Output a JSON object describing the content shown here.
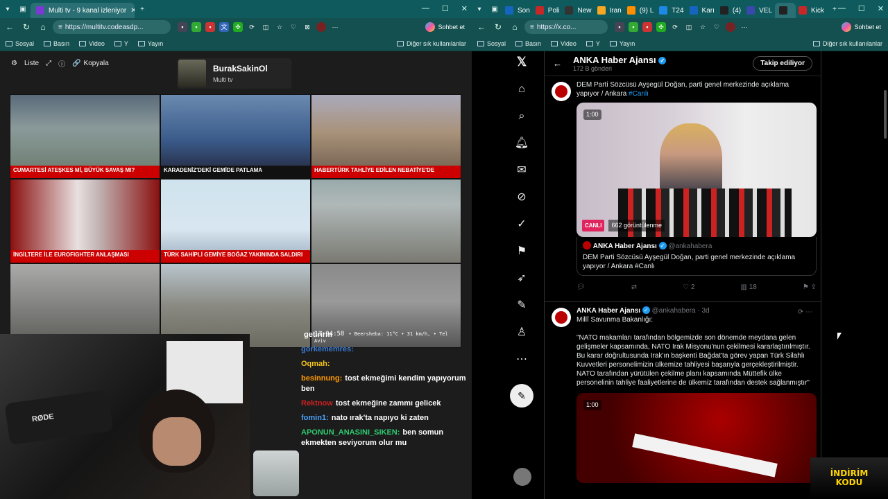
{
  "left_browser": {
    "active_tab": "Multi tv - 9 kanal izleniyor",
    "url": "https://multitv.codeasdp...",
    "copilot": "Sohbet et",
    "bookmarks": [
      "Sosyal",
      "Basın",
      "Video",
      "Y",
      "Yayın"
    ],
    "other_bookmarks": "Diğer sık kullanılanlar"
  },
  "right_browser": {
    "tabs": [
      "Son",
      "Poli",
      "New",
      "Iran",
      "(9) L",
      "T24",
      "Karı",
      "(4) ",
      "VEL",
      "",
      "Kick"
    ],
    "url": "https://x.co...",
    "copilot": "Sohbet et",
    "bookmarks": [
      "Sosyal",
      "Basın",
      "Video",
      "Y",
      "Yayın"
    ],
    "other_bookmarks": "Diğer sık kullanılanlar"
  },
  "multitv": {
    "toolbar": {
      "list": "Liste",
      "copy": "Kopyala"
    },
    "channel": {
      "name": "BurakSakinOl",
      "sub": "Multi tv"
    },
    "tiles": [
      {
        "banner": "CUMARTESİ ATEŞKES Mİ, BÜYÜK SAVAŞ MI?",
        "style": "c1"
      },
      {
        "banner": "KARADENİZ'DEKİ GEMİDE PATLAMA",
        "style": "c2"
      },
      {
        "banner": "HABERTÜRK TAHLİYE EDİLEN NEBATİYE'DE",
        "style": "c3"
      },
      {
        "banner": "İNGİLTERE İLE EUROFIGHTER ANLAŞMASI",
        "style": "c4"
      },
      {
        "banner": "TÜRK SAHİPLİ GEMİYE BOĞAZ YAKININDA SALDIRI",
        "style": "c5"
      },
      {
        "banner": "",
        "style": "c6"
      },
      {
        "banner": "",
        "style": "c7"
      },
      {
        "banner": "",
        "style": "c8"
      },
      {
        "banner": "",
        "style": "c9"
      }
    ],
    "clock": "11:04:58",
    "weather": "• Beersheba: 11°C • 31 km/h, • Tel Aviv"
  },
  "chat": [
    {
      "user": "",
      "text": "getirirm",
      "color": "#ffffff"
    },
    {
      "user": "gorkememres:",
      "text": "",
      "color": "#3a7bd5"
    },
    {
      "user": "Oqmah:",
      "text": "",
      "color": "#f5c518"
    },
    {
      "user": "besinnung:",
      "text": "tost ekmeğimi kendim yapıyorum ben",
      "color": "#ff9900"
    },
    {
      "user": "Rektnow",
      "text": "tost ekmeğine zammı gelicek",
      "color": "#cc2222"
    },
    {
      "user": "fomin1:",
      "text": "nato ırak'ta napıyo ki zaten",
      "color": "#4aa3ff"
    },
    {
      "user": "APONUN_ANASINI_SIKEN:",
      "text": "ben somun ekmekten seviyorum olur mu",
      "color": "#2ecc71"
    }
  ],
  "xfeed": {
    "header_title": "ANKA Haber Ajansı",
    "header_sub": "172 B gönderi",
    "follow": "Takip ediliyor",
    "tweet1": {
      "text": "DEM Parti Sözcüsü Ayşegül Doğan, parti genel merkezinde açıklama yapıyor / Ankara",
      "hashtag": "#Canlı",
      "duration": "1:00",
      "live": "CANLI",
      "views": "662 görüntülenme",
      "quote_name": "ANKA Haber Ajansı",
      "quote_handle": "@ankahabera",
      "quote_text": "DEM Parti Sözcüsü Ayşegül Doğan, parti genel merkezinde açıklama yapıyor / Ankara #Canlı",
      "likes": "2",
      "views_count": "18"
    },
    "tweet2": {
      "name": "ANKA Haber Ajansı",
      "handle": "@ankahabera · 3d",
      "text": "Millî Savunma Bakanlığı:\n\n\"NATO makamları tarafından bölgemizde son dönemde meydana gelen gelişmeler kapsamında, NATO Irak Misyonu'nun çekilmesi kararlaştırılmıştır. Bu karar doğrultusunda Irak'ın başkenti Bağdat'ta görev yapan Türk Silahlı Kuvvetleri personelimizin ülkemize tahliyesi başarıyla gerçekleştirilmiştir. NATO tarafından yürütülen çekilme planı kapsamında Müttefik ülke personelinin tahliye faaliyetlerine de ülkemiz tarafından destek sağlanmıştır\"",
      "duration": "1:00"
    }
  },
  "overlay": {
    "line1": "İNDİRİM",
    "line2": "KODU"
  }
}
